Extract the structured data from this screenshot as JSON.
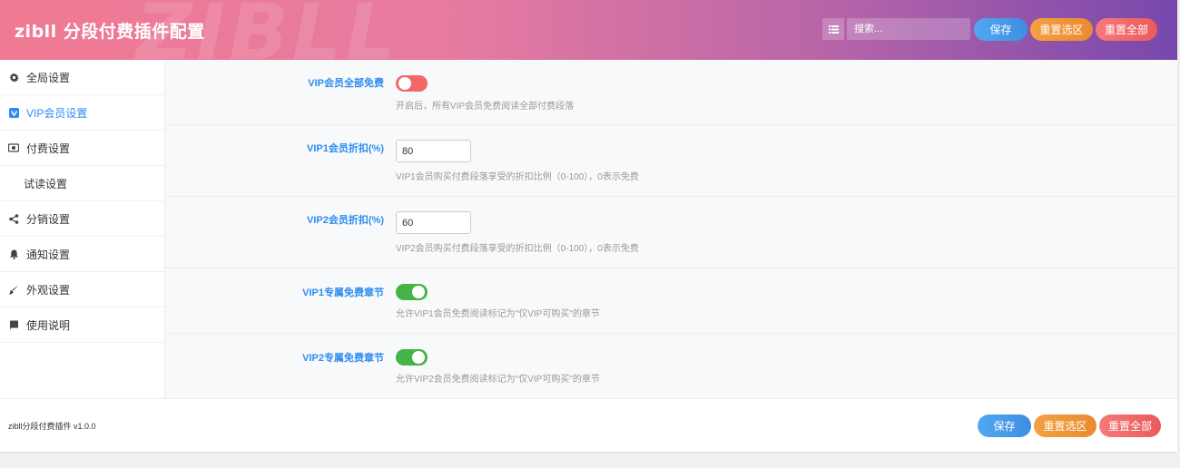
{
  "header": {
    "title": "zibll 分段付费插件配置",
    "watermark": "ZIBLL",
    "search_placeholder": "搜索...",
    "save_label": "保存",
    "reset_section_label": "重置选区",
    "reset_all_label": "重置全部"
  },
  "sidebar": {
    "items": [
      {
        "label": "全局设置",
        "icon": "gear-icon"
      },
      {
        "label": "VIP会员设置",
        "icon": "vip-icon",
        "active": true
      },
      {
        "label": "付费设置",
        "icon": "money-icon"
      },
      {
        "label": "试读设置",
        "icon": ""
      },
      {
        "label": "分销设置",
        "icon": "share-icon"
      },
      {
        "label": "通知设置",
        "icon": "bell-icon"
      },
      {
        "label": "外观设置",
        "icon": "brush-icon"
      },
      {
        "label": "使用说明",
        "icon": "book-icon"
      }
    ]
  },
  "settings": [
    {
      "label": "VIP会员全部免费",
      "type": "toggle",
      "value": false,
      "desc": "开启后，所有VIP会员免费阅读全部付费段落"
    },
    {
      "label": "VIP1会员折扣(%)",
      "type": "number",
      "value": "80",
      "desc": "VIP1会员购买付费段落享受的折扣比例（0-100），0表示免费"
    },
    {
      "label": "VIP2会员折扣(%)",
      "type": "number",
      "value": "60",
      "desc": "VIP2会员购买付费段落享受的折扣比例（0-100），0表示免费"
    },
    {
      "label": "VIP1专属免费章节",
      "type": "toggle",
      "value": true,
      "desc": "允许VIP1会员免费阅读标记为\"仅VIP可购买\"的章节"
    },
    {
      "label": "VIP2专属免费章节",
      "type": "toggle",
      "value": true,
      "desc": "允许VIP2会员免费阅读标记为\"仅VIP可购买\"的章节"
    }
  ],
  "footer": {
    "version": "zibll分段付费插件 v1.0.0",
    "save_label": "保存",
    "reset_section_label": "重置选区",
    "reset_all_label": "重置全部"
  },
  "colors": {
    "accent": "#2d8cf0",
    "toggle_on": "#45b345",
    "toggle_off": "#f26767"
  }
}
